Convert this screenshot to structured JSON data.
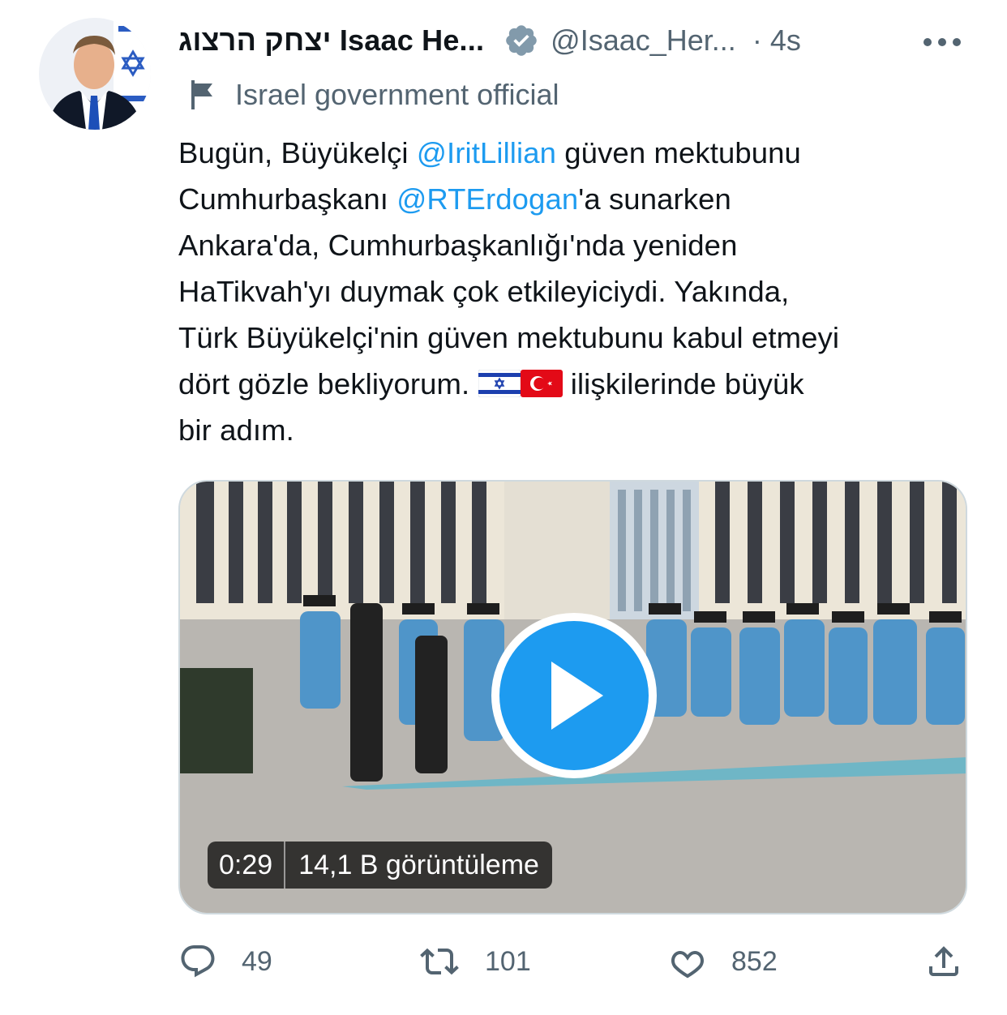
{
  "tweet": {
    "display_name": "יצחק הרצוג Isaac He...",
    "handle": "@Isaac_Her...",
    "separator": "·",
    "time": "4s",
    "affiliation": "Israel government official",
    "text": {
      "l1a": "Bugün, Büyükelçi ",
      "l1m": "@IritLillian",
      "l1b": " güven mektubunu",
      "l2a": "Cumhurbaşkanı ",
      "l2m": "@RTErdogan",
      "l2b": "'a sunarken",
      "l3": "Ankara'da, Cumhurbaşkanlığı'nda yeniden",
      "l4": "HaTikvah'yı duymak çok etkileyiciydi. Yakında,",
      "l5": "Türk Büyükelçi'nin güven mektubunu kabul etmeyi",
      "l6a": "dört gözle bekliyorum. ",
      "l6b": " ilişkilerinde büyük",
      "l7": "bir adım."
    },
    "video": {
      "duration": "0:29",
      "views": "14,1 B görüntüleme"
    },
    "stats": {
      "replies": "49",
      "retweets": "101",
      "likes": "852"
    }
  },
  "icons": [
    "verified-badge-icon",
    "more-icon",
    "flag-icon",
    "israel-flag-icon",
    "turkey-flag-icon",
    "play-icon",
    "reply-icon",
    "retweet-icon",
    "like-icon",
    "share-icon"
  ],
  "colors": {
    "accent": "#1d9bf0",
    "secondary_text": "#536471",
    "verified_badge": "#829aab",
    "border": "#cfd9de"
  }
}
